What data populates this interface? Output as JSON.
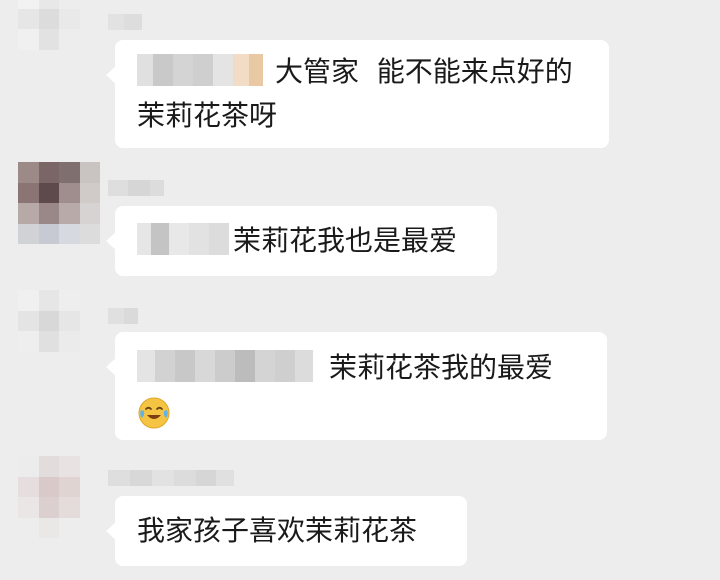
{
  "messages": [
    {
      "text": "大管家  能不能来点好的",
      "text2": "茉莉花茶呀"
    },
    {
      "text": "茉莉花我也是最爱"
    },
    {
      "text": "茉莉花茶我的最爱",
      "emoji": "laughing-crying-emoji"
    },
    {
      "text": "我家孩子喜欢茉莉花茶"
    }
  ],
  "colors": {
    "background": "#ededed",
    "bubble": "#ffffff",
    "text": "#1a1a1a"
  }
}
